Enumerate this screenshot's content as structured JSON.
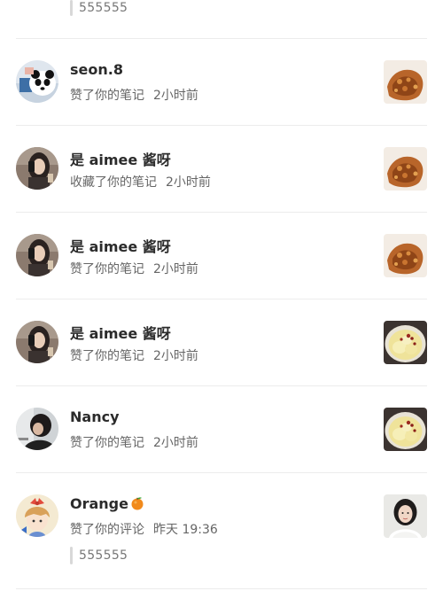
{
  "top_quote": {
    "text": "555555"
  },
  "notifications": [
    {
      "name": "seon.8",
      "action": "赞了你的笔记",
      "time": "2小时前",
      "avatar_icon": "panda-avatar",
      "thumb_icon": "fried-chicken-photo"
    },
    {
      "name": "是 aimee 酱呀",
      "action": "收藏了你的笔记",
      "time": "2小时前",
      "avatar_icon": "girl-selfie-avatar",
      "thumb_icon": "fried-chicken-photo"
    },
    {
      "name": "是 aimee 酱呀",
      "action": "赞了你的笔记",
      "time": "2小时前",
      "avatar_icon": "girl-selfie-avatar",
      "thumb_icon": "fried-chicken-photo"
    },
    {
      "name": "是 aimee 酱呀",
      "action": "赞了你的笔记",
      "time": "2小时前",
      "avatar_icon": "girl-selfie-avatar",
      "thumb_icon": "pear-soup-photo"
    },
    {
      "name": "Nancy",
      "action": "赞了你的笔记",
      "time": "2小时前",
      "avatar_icon": "dark-portrait-avatar",
      "thumb_icon": "pear-soup-photo"
    },
    {
      "name": "Orange",
      "action": "赞了你的评论",
      "time": "昨天 19:36",
      "avatar_icon": "cartoon-girl-avatar",
      "thumb_icon": "portrait-photo",
      "name_emoji": "orange-emoji",
      "reply_quote": "555555"
    }
  ],
  "colors": {
    "divider": "#ececec",
    "quote_bar": "#d8d8d8",
    "name_text": "#2b2b2b",
    "meta_text": "#666666"
  }
}
